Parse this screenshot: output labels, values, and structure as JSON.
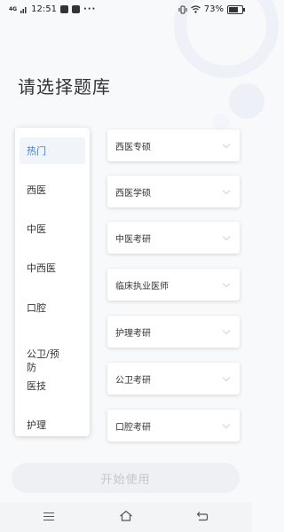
{
  "status_bar": {
    "signal_text": "4G",
    "time": "12:51",
    "more": "···",
    "battery_percent": "73%",
    "battery_level": 0.73
  },
  "page_title": "请选择题库",
  "categories": [
    {
      "label": "热门",
      "active": true
    },
    {
      "label": "西医",
      "active": false
    },
    {
      "label": "中医",
      "active": false
    },
    {
      "label": "中西医",
      "active": false
    },
    {
      "label": "口腔",
      "active": false
    },
    {
      "label": "公卫/预\n防",
      "active": false
    },
    {
      "label": "医技",
      "active": false
    },
    {
      "label": "护理",
      "active": false
    }
  ],
  "exams": [
    {
      "label": "西医专硕"
    },
    {
      "label": "西医学硕"
    },
    {
      "label": "中医考研"
    },
    {
      "label": "临床执业医师"
    },
    {
      "label": "护理考研"
    },
    {
      "label": "公卫考研"
    },
    {
      "label": "口腔考研"
    }
  ],
  "start_button": {
    "label": "开始使用"
  },
  "icons": {
    "chevron": "chevron-down-icon",
    "menu": "menu-icon",
    "home": "home-icon",
    "back": "back-icon"
  },
  "colors": {
    "accent": "#4a7fc9",
    "background": "#f8f9fb",
    "disabled_text": "#c4c7cc"
  }
}
